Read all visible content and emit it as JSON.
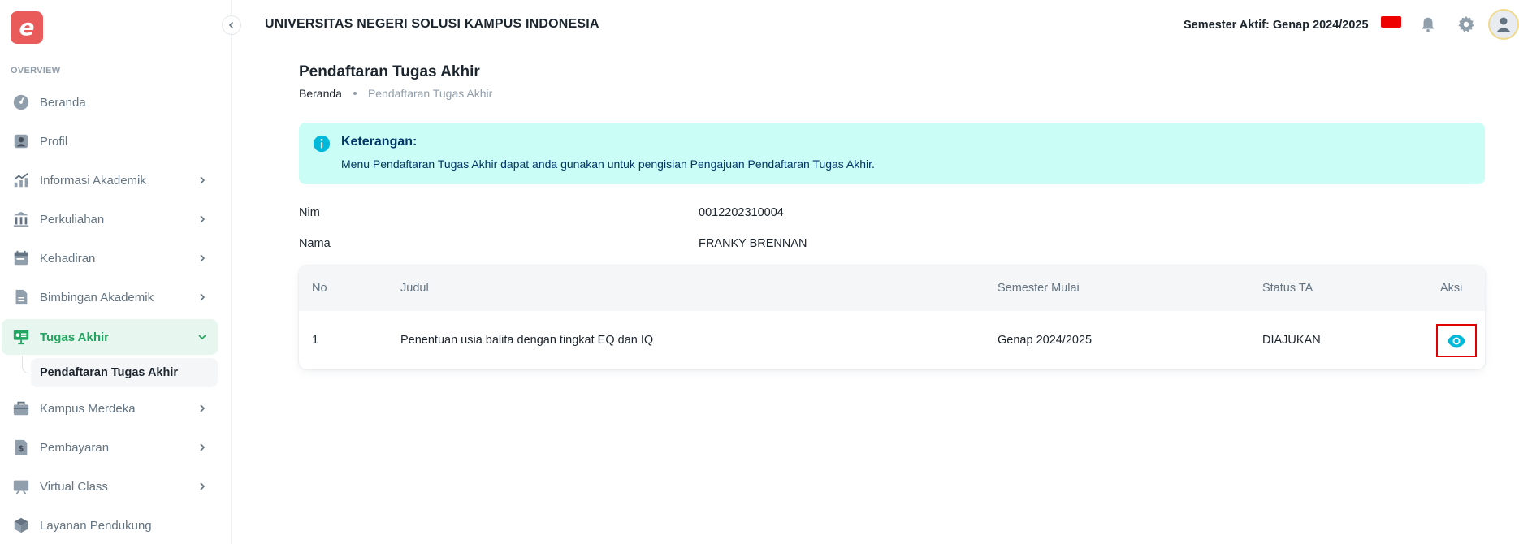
{
  "app": {
    "logo_letter": "e",
    "university": "UNIVERSITAS NEGERI SOLUSI KAMPUS INDONESIA",
    "semester": "Semester Aktif: Genap 2024/2025"
  },
  "sidebar": {
    "section": "OVERVIEW",
    "items": [
      {
        "label": "Beranda",
        "icon": "dashboard-icon"
      },
      {
        "label": "Profil",
        "icon": "profile-icon"
      },
      {
        "label": "Informasi Akademik",
        "icon": "chart-icon"
      },
      {
        "label": "Perkuliahan",
        "icon": "building-icon"
      },
      {
        "label": "Kehadiran",
        "icon": "calendar-icon"
      },
      {
        "label": "Bimbingan Akademik",
        "icon": "document-icon"
      },
      {
        "label": "Tugas Akhir",
        "icon": "presentation-icon"
      },
      {
        "label": "Kampus Merdeka",
        "icon": "briefcase-icon"
      },
      {
        "label": "Pembayaran",
        "icon": "invoice-icon"
      },
      {
        "label": "Virtual Class",
        "icon": "screen-icon"
      },
      {
        "label": "Layanan Pendukung",
        "icon": "support-box-icon"
      }
    ],
    "sub_item": "Pendaftaran Tugas Akhir"
  },
  "page": {
    "title": "Pendaftaran Tugas Akhir",
    "breadcrumb": [
      "Beranda",
      "Pendaftaran Tugas Akhir"
    ]
  },
  "alert": {
    "title": "Keterangan:",
    "description": "Menu Pendaftaran Tugas Akhir dapat anda gunakan untuk pengisian Pengajuan Pendaftaran Tugas Akhir."
  },
  "student": {
    "nim_label": "Nim",
    "nim": "0012202310004",
    "nama_label": "Nama",
    "nama": "FRANKY BRENNAN"
  },
  "table": {
    "headers": [
      "No",
      "Judul",
      "Semester Mulai",
      "Status TA",
      "Aksi"
    ],
    "rows": [
      {
        "no": "1",
        "judul": "Penentuan usia balita dengan tingkat EQ dan IQ",
        "semester": "Genap 2024/2025",
        "status": "DIAJUKAN"
      }
    ]
  },
  "colors": {
    "accent": "#22a560",
    "alert_bg": "#cafdf5",
    "alert_text": "#003768",
    "eye": "#00b8d9",
    "highlight": "#e10000"
  }
}
